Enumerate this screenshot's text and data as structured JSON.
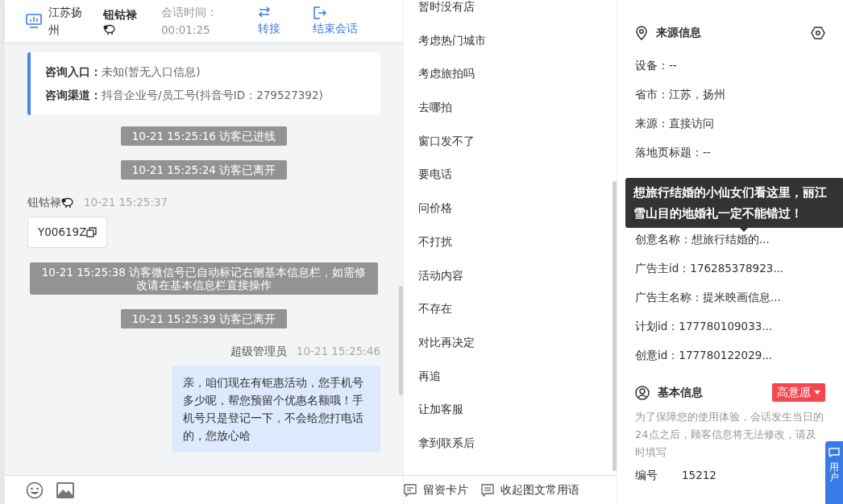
{
  "header": {
    "location": "江苏扬州",
    "visitor_name": "钮钴禄",
    "session_time_label": "会话时间：",
    "session_time": "00:01:25",
    "actions": [
      {
        "kind": "transfer",
        "label": "转接"
      },
      {
        "kind": "end",
        "label": "结束会话"
      }
    ]
  },
  "consult_info": [
    {
      "label": "咨询入口：",
      "value": "未知(暂无入口信息)"
    },
    {
      "label": "咨询渠道：",
      "value": "抖音企业号/员工号(抖音号ID：279527392)"
    }
  ],
  "messages": [
    {
      "kind": "system",
      "text": "10-21 15:25:16 访客已进线"
    },
    {
      "kind": "system",
      "text": "10-21 15:25:24 访客已离开"
    },
    {
      "kind": "visitor",
      "sender": "钮钴禄",
      "time": "10-21 15:25:37",
      "text": "Y00619Z"
    },
    {
      "kind": "system",
      "text": "10-21 15:25:38 访客微信号已自动标记右侧基本信息栏，如需修改请在基本信息栏直接操作"
    },
    {
      "kind": "system",
      "text": "10-21 15:25:39 访客已离开"
    },
    {
      "kind": "agent",
      "sender": "超级管理员",
      "time": "10-21 15:25:46",
      "text": "亲，咱们现在有钜惠活动，您手机号多少呢，帮您预留个优惠名额哦！手机号只是登记一下，不会给您打电话的，您放心哈"
    }
  ],
  "phrases": [
    "暂时没有店",
    "考虑热门城市",
    "考虑旅拍吗",
    "去哪拍",
    "窗口发不了",
    "要电话",
    "问价格",
    "不打扰",
    "活动内容",
    "不存在",
    "对比再决定",
    "再追",
    "让加客服",
    "拿到联系后"
  ],
  "phrase_actions": [
    {
      "kind": "card",
      "label": "留资卡片"
    },
    {
      "kind": "collapse",
      "label": "收起图文常用语"
    }
  ],
  "source_info": {
    "title": "来源信息",
    "fields": [
      "设备：--",
      "省市：江苏，扬州",
      "来源：直接访问",
      "落地页标题：--",
      "创意名称：想旅行结婚的...",
      "广告主id：176285378923...",
      "广告主名称：提米映画信息...",
      "计划id：177780109033...",
      "创意id：177780122029..."
    ],
    "tooltip": "想旅行结婚的小仙女们看这里，丽江雪山目的地婚礼一定不能错过！"
  },
  "basic_info": {
    "title": "基本信息",
    "intent": "高意愿",
    "notice": "为了保障您的使用体验，会话发生当日的24点之后，顾客信息将无法修改，请及时填写",
    "fields": [
      {
        "label": "编号",
        "value": "15212"
      }
    ]
  },
  "feedback_tab": {
    "label": "用户"
  }
}
